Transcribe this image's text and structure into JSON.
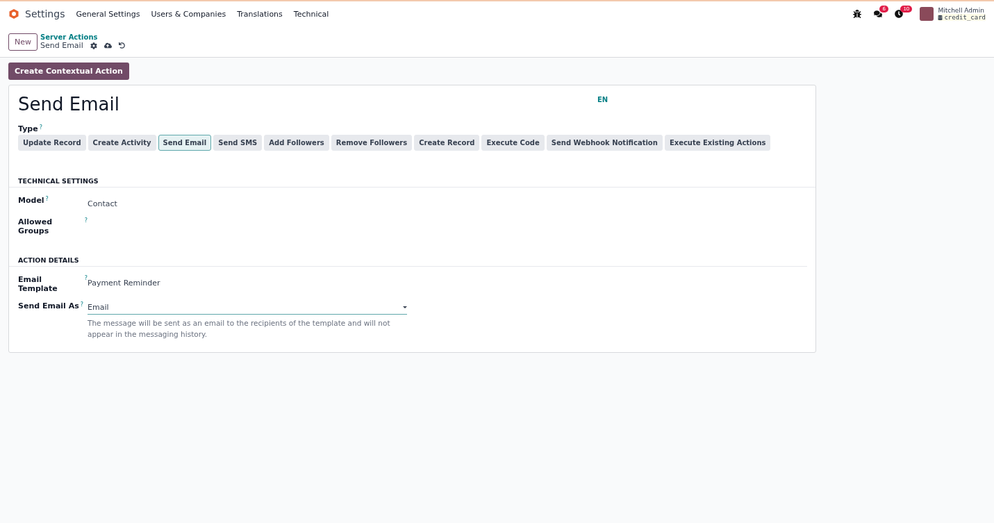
{
  "navbar": {
    "app_name": "Settings",
    "menu": [
      "General Settings",
      "Users & Companies",
      "Translations",
      "Technical"
    ],
    "messages_badge": "6",
    "activities_badge": "10",
    "user_name": "Mitchell Admin",
    "database": "credit_card"
  },
  "control_panel": {
    "new_button": "New",
    "breadcrumb_parent": "Server Actions",
    "breadcrumb_current": "Send Email"
  },
  "contextual_button": "Create Contextual Action",
  "form": {
    "title": "Send Email",
    "language": "EN",
    "type_label": "Type",
    "type_help": "?",
    "types": [
      {
        "label": "Update Record",
        "selected": false
      },
      {
        "label": "Create Activity",
        "selected": false
      },
      {
        "label": "Send Email",
        "selected": true
      },
      {
        "label": "Send SMS",
        "selected": false
      },
      {
        "label": "Add Followers",
        "selected": false
      },
      {
        "label": "Remove Followers",
        "selected": false
      },
      {
        "label": "Create Record",
        "selected": false
      },
      {
        "label": "Execute Code",
        "selected": false
      },
      {
        "label": "Send Webhook Notification",
        "selected": false
      },
      {
        "label": "Execute Existing Actions",
        "selected": false
      }
    ],
    "sections": [
      {
        "title": "TECHNICAL SETTINGS",
        "fields": [
          {
            "kind": "text",
            "label": "Model",
            "help": "?",
            "value": "Contact"
          },
          {
            "kind": "text",
            "label": "Allowed Groups",
            "help": "?"
          }
        ]
      },
      {
        "title": "ACTION DETAILS",
        "fields": [
          {
            "kind": "text",
            "label": "Email Template",
            "help": "?",
            "value": "Payment Reminder"
          },
          {
            "kind": "select",
            "label": "Send Email As",
            "help": "?",
            "value": "Email",
            "hint": "The message will be sent as an email to the recipients of the template and will not appear in the messaging history."
          }
        ]
      }
    ]
  }
}
